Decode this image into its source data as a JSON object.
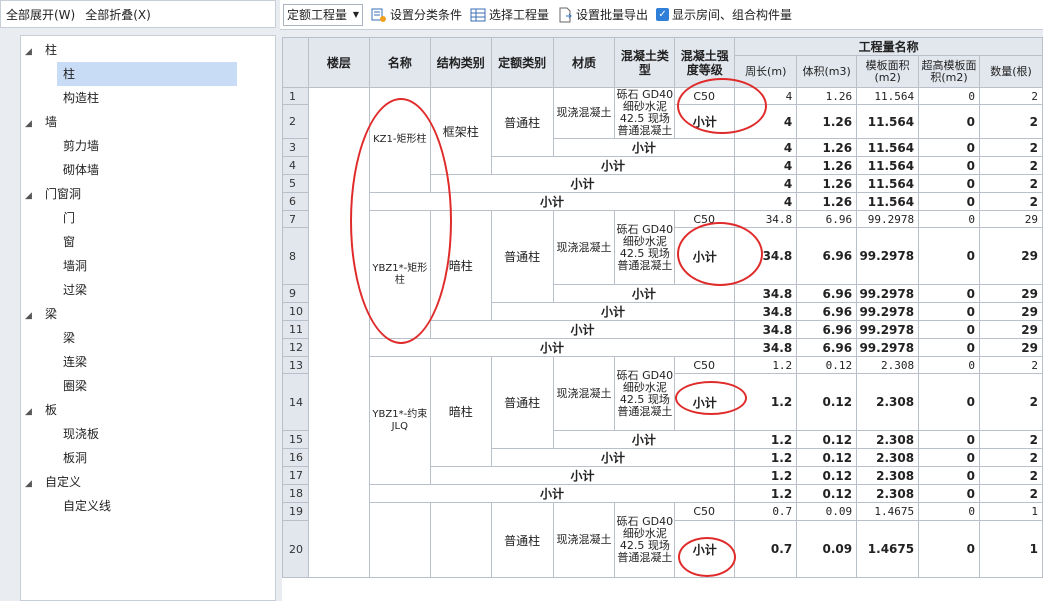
{
  "left_toolbar": {
    "expand_all": "全部展开(W)",
    "collapse_all": "全部折叠(X)"
  },
  "tree": [
    {
      "label": "柱",
      "children": [
        "柱",
        "构造柱"
      ]
    },
    {
      "label": "墙",
      "children": [
        "剪力墙",
        "砌体墙"
      ]
    },
    {
      "label": "门窗洞",
      "children": [
        "门",
        "窗",
        "墙洞",
        "过梁"
      ]
    },
    {
      "label": "梁",
      "children": [
        "梁",
        "连梁",
        "圈梁"
      ]
    },
    {
      "label": "板",
      "children": [
        "现浇板",
        "板洞"
      ]
    },
    {
      "label": "自定义",
      "children": [
        "自定义线"
      ]
    }
  ],
  "selected_tree_item": "柱",
  "toolbar": {
    "dropdown_value": "定额工程量",
    "set_category": "设置分类条件",
    "select_quantity": "选择工程量",
    "set_batch_export": "设置批量导出",
    "show_rooms": "显示房间、组合构件量"
  },
  "grid": {
    "headers": {
      "floor": "楼层",
      "name": "名称",
      "struct_type": "结构类别",
      "quota_type": "定额类别",
      "material": "材质",
      "concrete_type": "混凝土类型",
      "grade": "混凝土强度等级",
      "quantity_group": "工程量名称",
      "perimeter": "周长(m)",
      "volume": "体积(m3)",
      "formwork": "模板面积(m2)",
      "high_formwork": "超高模板面积(m2)",
      "count": "数量(根)"
    },
    "subtotal": "小计",
    "row_numbers": [
      "1",
      "2",
      "3",
      "4",
      "5",
      "6",
      "7",
      "8",
      "9",
      "10",
      "11",
      "12",
      "13",
      "14",
      "15",
      "16",
      "17",
      "18",
      "19",
      "20"
    ],
    "groups": [
      {
        "name": "KZ1-矩形柱",
        "struct": "框架柱",
        "quota": "普通柱",
        "material": "现浇混凝土",
        "concrete": "砾石 GD40 细砂水泥42.5 现场普通混凝土",
        "grade": "C50",
        "perimeter": "4",
        "volume": "1.26",
        "formwork": "11.564",
        "high": "0",
        "count": "2"
      },
      {
        "name": "YBZ1*-矩形柱",
        "struct": "暗柱",
        "quota": "普通柱",
        "material": "现浇混凝土",
        "concrete": "砾石 GD40 细砂水泥42.5 现场普通混凝土",
        "grade": "C50",
        "perimeter": "34.8",
        "volume": "6.96",
        "formwork": "99.2978",
        "high": "0",
        "count": "29"
      },
      {
        "name": "YBZ1*-约束JLQ",
        "struct": "暗柱",
        "quota": "普通柱",
        "material": "现浇混凝土",
        "concrete": "砾石 GD40 细砂水泥42.5 现场普通混凝土",
        "grade": "C50",
        "perimeter": "1.2",
        "volume": "0.12",
        "formwork": "2.308",
        "high": "0",
        "count": "2"
      },
      {
        "name": "",
        "struct": "",
        "quota": "普通柱",
        "material": "现浇混凝土",
        "concrete": "砾石 GD40 细砂水泥42.5 现场普通混凝土",
        "grade": "C50",
        "perimeter": "0.7",
        "volume": "0.09",
        "formwork": "1.4675",
        "high": "0",
        "count": "1"
      }
    ]
  },
  "colors": {
    "annotation": "#e02b2b",
    "selected": "#c9dcf5",
    "header": "#e2e7ee"
  }
}
